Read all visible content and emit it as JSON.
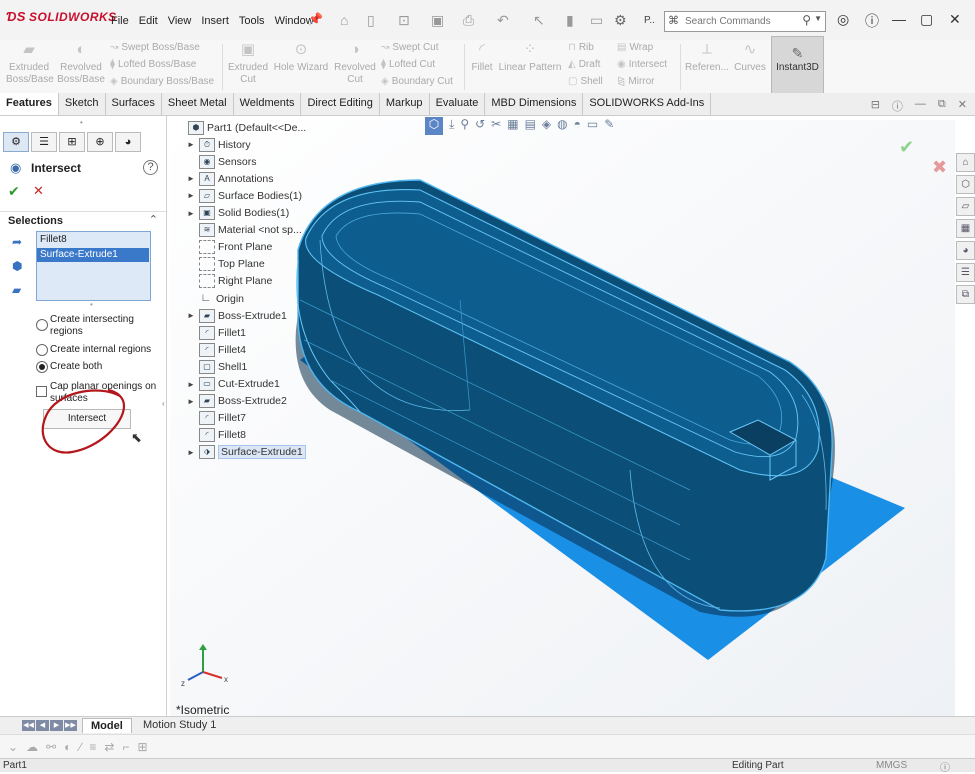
{
  "app": {
    "logo_text": "SOLIDWORKS"
  },
  "menu": [
    "File",
    "Edit",
    "View",
    "Insert",
    "Tools",
    "Window"
  ],
  "quick_access": {
    "more_label": "P.."
  },
  "search": {
    "placeholder": "Search Commands"
  },
  "ribbon": {
    "features": [
      {
        "label_line1": "Extruded",
        "label_line2": "Boss/Base",
        "icon": "extruded-boss-icon"
      },
      {
        "label_line1": "Revolved",
        "label_line2": "Boss/Base",
        "icon": "revolved-boss-icon"
      }
    ],
    "boss_group": [
      "Swept Boss/Base",
      "Lofted Boss/Base",
      "Boundary Boss/Base"
    ],
    "cut_big": [
      {
        "label_line1": "Extruded",
        "label_line2": "Cut"
      },
      {
        "label_line1": "Hole Wizard",
        "label_line2": ""
      },
      {
        "label_line1": "Revolved",
        "label_line2": "Cut"
      }
    ],
    "cut_group": [
      "Swept Cut",
      "Lofted Cut",
      "Boundary Cut"
    ],
    "fillet": "Fillet",
    "linear_pattern": "Linear Pattern",
    "rib_group": [
      "Rib",
      "Draft",
      "Shell"
    ],
    "wrap_group": [
      "Wrap",
      "Intersect",
      "Mirror"
    ],
    "reference": "Referen...",
    "curves": "Curves",
    "instant3d": "Instant3D"
  },
  "tabs": [
    "Features",
    "Sketch",
    "Surfaces",
    "Sheet Metal",
    "Weldments",
    "Direct Editing",
    "Markup",
    "Evaluate",
    "MBD Dimensions",
    "SOLIDWORKS Add-Ins"
  ],
  "property_manager": {
    "title": "Intersect",
    "selections_header": "Selections",
    "selections": [
      "Fillet8",
      "Surface-Extrude1"
    ],
    "options": [
      {
        "label_line1": "Create intersecting",
        "label_line2": "regions",
        "selected": false
      },
      {
        "label_line1": "Create internal regions",
        "label_line2": "",
        "selected": false
      },
      {
        "label_line1": "Create both",
        "label_line2": "",
        "selected": true
      }
    ],
    "cap_label_line1": "Cap planar openings on",
    "cap_label_line2": "surfaces",
    "cap_checked": false,
    "intersect_button": "Intersect"
  },
  "feature_tree": [
    {
      "label": "Part1  (Default<<De...",
      "icon": "part-icon",
      "expand": false,
      "kind": "root"
    },
    {
      "label": "History",
      "icon": "history-icon",
      "expand": true
    },
    {
      "label": "Sensors",
      "icon": "sensors-icon",
      "expand": false
    },
    {
      "label": "Annotations",
      "icon": "annotations-icon",
      "expand": true
    },
    {
      "label": "Surface Bodies(1)",
      "icon": "surface-bodies-icon",
      "expand": true
    },
    {
      "label": "Solid Bodies(1)",
      "icon": "solid-bodies-icon",
      "expand": true
    },
    {
      "label": "Material <not sp...",
      "icon": "material-icon",
      "expand": false
    },
    {
      "label": "Front Plane",
      "icon": "plane-icon",
      "expand": false
    },
    {
      "label": "Top Plane",
      "icon": "plane-icon",
      "expand": false
    },
    {
      "label": "Right Plane",
      "icon": "plane-icon",
      "expand": false
    },
    {
      "label": "Origin",
      "icon": "origin-icon",
      "expand": false
    },
    {
      "label": "Boss-Extrude1",
      "icon": "boss-extrude-icon",
      "expand": true
    },
    {
      "label": "Fillet1",
      "icon": "fillet-icon",
      "expand": false
    },
    {
      "label": "Fillet4",
      "icon": "fillet-icon",
      "expand": false
    },
    {
      "label": "Shell1",
      "icon": "shell-icon",
      "expand": false
    },
    {
      "label": "Cut-Extrude1",
      "icon": "cut-extrude-icon",
      "expand": true
    },
    {
      "label": "Boss-Extrude2",
      "icon": "boss-extrude-icon",
      "expand": true
    },
    {
      "label": "Fillet7",
      "icon": "fillet-icon",
      "expand": false
    },
    {
      "label": "Fillet8",
      "icon": "fillet-icon",
      "expand": false
    },
    {
      "label": "Surface-Extrude1",
      "icon": "surface-extrude-icon",
      "expand": true,
      "selected": true
    }
  ],
  "viewport": {
    "view_label": "*Isometric"
  },
  "bottom_tabs": [
    "Model",
    "Motion Study 1"
  ],
  "status": {
    "left": "Part1",
    "mode": "Editing Part",
    "units": "MMGS"
  },
  "colors": {
    "body": "#0b4f78",
    "body_edge": "#4fb6ef",
    "plane": "#1a8fe6",
    "accent": "#c8102e"
  }
}
